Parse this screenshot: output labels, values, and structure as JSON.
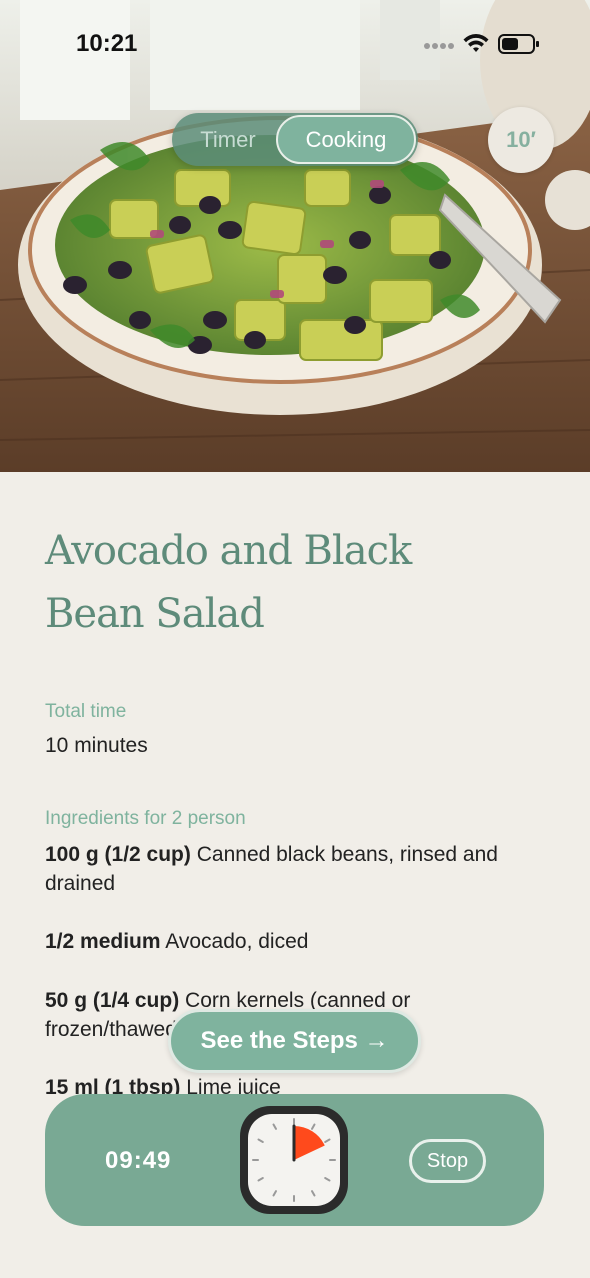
{
  "status_bar": {
    "time": "10:21"
  },
  "mode_toggle": {
    "options": [
      "Timer",
      "Cooking"
    ],
    "selected": "Cooking"
  },
  "duration_badge": "10′",
  "recipe": {
    "title_line1": "Avocado and Black",
    "title_line2": "Bean Salad",
    "total_time_label": "Total time",
    "total_time_value": "10 minutes",
    "ingredients_label": "Ingredients for 2 person",
    "ingredients": [
      {
        "quantity": "100 g (1/2 cup)",
        "name": "Canned black beans, rinsed and drained"
      },
      {
        "quantity": "1/2 medium",
        "name": "Avocado, diced"
      },
      {
        "quantity": "50 g (1/4 cup)",
        "name": "Corn kernels (canned or frozen/thawed)"
      },
      {
        "quantity": "15 ml (1 tbsp)",
        "name": "Lime juice"
      }
    ]
  },
  "steps_button": "See the Steps →",
  "timer": {
    "countdown": "09:49",
    "stop_label": "Stop",
    "elapsed_fraction": 0.18
  },
  "colors": {
    "accent": "#7fb39e",
    "timer_bar": "#79a994",
    "background": "#f1eee8",
    "timer_wedge": "#ff4a1c"
  }
}
